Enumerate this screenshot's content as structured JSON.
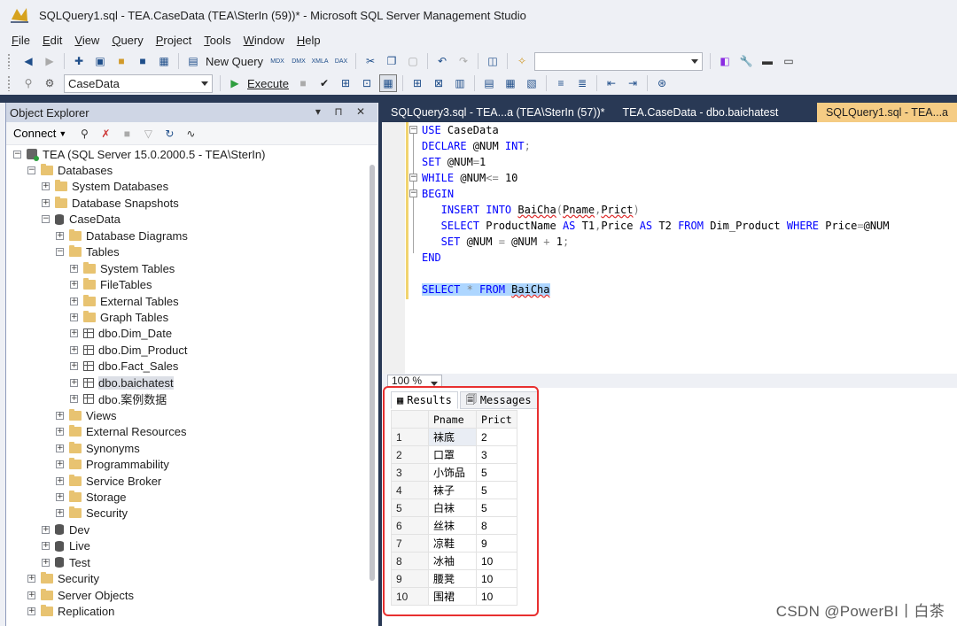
{
  "window": {
    "title": "SQLQuery1.sql - TEA.CaseData (TEA\\SterIn (59))* - Microsoft SQL Server Management Studio"
  },
  "menu": [
    "File",
    "Edit",
    "View",
    "Query",
    "Project",
    "Tools",
    "Window",
    "Help"
  ],
  "toolbar": {
    "new_query": "New Query",
    "execute": "Execute",
    "database": "CaseData"
  },
  "object_explorer": {
    "title": "Object Explorer",
    "connect": "Connect",
    "tree": [
      {
        "label": "TEA (SQL Server 15.0.2000.5 - TEA\\SterIn)",
        "level": 0,
        "icon": "server",
        "exp": "-"
      },
      {
        "label": "Databases",
        "level": 1,
        "icon": "folder",
        "exp": "-"
      },
      {
        "label": "System Databases",
        "level": 2,
        "icon": "folder",
        "exp": "+"
      },
      {
        "label": "Database Snapshots",
        "level": 2,
        "icon": "folder",
        "exp": "+"
      },
      {
        "label": "CaseData",
        "level": 2,
        "icon": "database",
        "exp": "-"
      },
      {
        "label": "Database Diagrams",
        "level": 3,
        "icon": "folder",
        "exp": "+"
      },
      {
        "label": "Tables",
        "level": 3,
        "icon": "folder",
        "exp": "-"
      },
      {
        "label": "System Tables",
        "level": 4,
        "icon": "folder",
        "exp": "+"
      },
      {
        "label": "FileTables",
        "level": 4,
        "icon": "folder",
        "exp": "+"
      },
      {
        "label": "External Tables",
        "level": 4,
        "icon": "folder",
        "exp": "+"
      },
      {
        "label": "Graph Tables",
        "level": 4,
        "icon": "folder",
        "exp": "+"
      },
      {
        "label": "dbo.Dim_Date",
        "level": 4,
        "icon": "table",
        "exp": "+"
      },
      {
        "label": "dbo.Dim_Product",
        "level": 4,
        "icon": "table",
        "exp": "+"
      },
      {
        "label": "dbo.Fact_Sales",
        "level": 4,
        "icon": "table",
        "exp": "+"
      },
      {
        "label": "dbo.baichatest",
        "level": 4,
        "icon": "table",
        "exp": "+",
        "selected": true
      },
      {
        "label": "dbo.案例数据",
        "level": 4,
        "icon": "table",
        "exp": "+"
      },
      {
        "label": "Views",
        "level": 3,
        "icon": "folder",
        "exp": "+"
      },
      {
        "label": "External Resources",
        "level": 3,
        "icon": "folder",
        "exp": "+"
      },
      {
        "label": "Synonyms",
        "level": 3,
        "icon": "folder",
        "exp": "+"
      },
      {
        "label": "Programmability",
        "level": 3,
        "icon": "folder",
        "exp": "+"
      },
      {
        "label": "Service Broker",
        "level": 3,
        "icon": "folder",
        "exp": "+"
      },
      {
        "label": "Storage",
        "level": 3,
        "icon": "folder",
        "exp": "+"
      },
      {
        "label": "Security",
        "level": 3,
        "icon": "folder",
        "exp": "+"
      },
      {
        "label": "Dev",
        "level": 2,
        "icon": "database",
        "exp": "+"
      },
      {
        "label": "Live",
        "level": 2,
        "icon": "database",
        "exp": "+"
      },
      {
        "label": "Test",
        "level": 2,
        "icon": "database",
        "exp": "+"
      },
      {
        "label": "Security",
        "level": 1,
        "icon": "folder",
        "exp": "+"
      },
      {
        "label": "Server Objects",
        "level": 1,
        "icon": "folder",
        "exp": "+"
      },
      {
        "label": "Replication",
        "level": 1,
        "icon": "folder",
        "exp": "+"
      }
    ]
  },
  "tabs": [
    {
      "label": "SQLQuery3.sql - TEA...a (TEA\\SterIn (57))*",
      "active": false
    },
    {
      "label": "TEA.CaseData - dbo.baichatest",
      "active": false
    },
    {
      "label": "SQLQuery1.sql - TEA...a",
      "active": true
    }
  ],
  "editor": {
    "lines": [
      [
        {
          "t": "USE ",
          "c": "kw"
        },
        {
          "t": "CaseData",
          "c": "tx"
        }
      ],
      [
        {
          "t": "DECLARE ",
          "c": "kw"
        },
        {
          "t": "@NUM ",
          "c": "tx"
        },
        {
          "t": "INT",
          "c": "kw"
        },
        {
          "t": ";",
          "c": "gray"
        }
      ],
      [
        {
          "t": "SET ",
          "c": "kw"
        },
        {
          "t": "@NUM",
          "c": "tx"
        },
        {
          "t": "=",
          "c": "gray"
        },
        {
          "t": "1",
          "c": "tx"
        }
      ],
      [
        {
          "t": "WHILE ",
          "c": "kw"
        },
        {
          "t": "@NUM",
          "c": "tx"
        },
        {
          "t": "<=",
          "c": "gray"
        },
        {
          "t": " 10",
          "c": "tx"
        }
      ],
      [
        {
          "t": "BEGIN",
          "c": "kw"
        }
      ],
      [
        {
          "t": "   INSERT INTO ",
          "c": "kw"
        },
        {
          "t": "BaiCha",
          "c": "tx sq"
        },
        {
          "t": "(",
          "c": "gray"
        },
        {
          "t": "Pname",
          "c": "tx sq"
        },
        {
          "t": ",",
          "c": "gray"
        },
        {
          "t": "Prict",
          "c": "tx sq"
        },
        {
          "t": ")",
          "c": "gray"
        }
      ],
      [
        {
          "t": "   SELECT ",
          "c": "kw"
        },
        {
          "t": "ProductName ",
          "c": "tx"
        },
        {
          "t": "AS ",
          "c": "kw"
        },
        {
          "t": "T1",
          "c": "tx"
        },
        {
          "t": ",",
          "c": "gray"
        },
        {
          "t": "Price ",
          "c": "tx"
        },
        {
          "t": "AS ",
          "c": "kw"
        },
        {
          "t": "T2 ",
          "c": "tx"
        },
        {
          "t": "FROM ",
          "c": "kw"
        },
        {
          "t": "Dim_Product ",
          "c": "tx"
        },
        {
          "t": "WHERE ",
          "c": "kw"
        },
        {
          "t": "Price",
          "c": "tx"
        },
        {
          "t": "=",
          "c": "gray"
        },
        {
          "t": "@NUM",
          "c": "tx"
        }
      ],
      [
        {
          "t": "   SET ",
          "c": "kw"
        },
        {
          "t": "@NUM ",
          "c": "tx"
        },
        {
          "t": "= ",
          "c": "gray"
        },
        {
          "t": "@NUM ",
          "c": "tx"
        },
        {
          "t": "+ ",
          "c": "gray"
        },
        {
          "t": "1",
          "c": "tx"
        },
        {
          "t": ";",
          "c": "gray"
        }
      ],
      [
        {
          "t": "END",
          "c": "kw"
        }
      ],
      [],
      [
        {
          "t": "SELECT ",
          "c": "kw hl"
        },
        {
          "t": "* ",
          "c": "gray hl"
        },
        {
          "t": "FROM ",
          "c": "kw hl"
        },
        {
          "t": "BaiCha",
          "c": "tx sq hl"
        }
      ]
    ]
  },
  "zoom": "100 %",
  "results": {
    "tabs": [
      "Results",
      "Messages"
    ],
    "columns": [
      "Pname",
      "Prict"
    ],
    "rows": [
      [
        "1",
        "袜底",
        "2"
      ],
      [
        "2",
        "口罩",
        "3"
      ],
      [
        "3",
        "小饰品",
        "5"
      ],
      [
        "4",
        "袜子",
        "5"
      ],
      [
        "5",
        "白袜",
        "5"
      ],
      [
        "6",
        "丝袜",
        "8"
      ],
      [
        "7",
        "凉鞋",
        "9"
      ],
      [
        "8",
        "冰袖",
        "10"
      ],
      [
        "9",
        "腰凳",
        "10"
      ],
      [
        "10",
        "围裙",
        "10"
      ]
    ]
  },
  "watermark": "CSDN @PowerBI丨白茶"
}
